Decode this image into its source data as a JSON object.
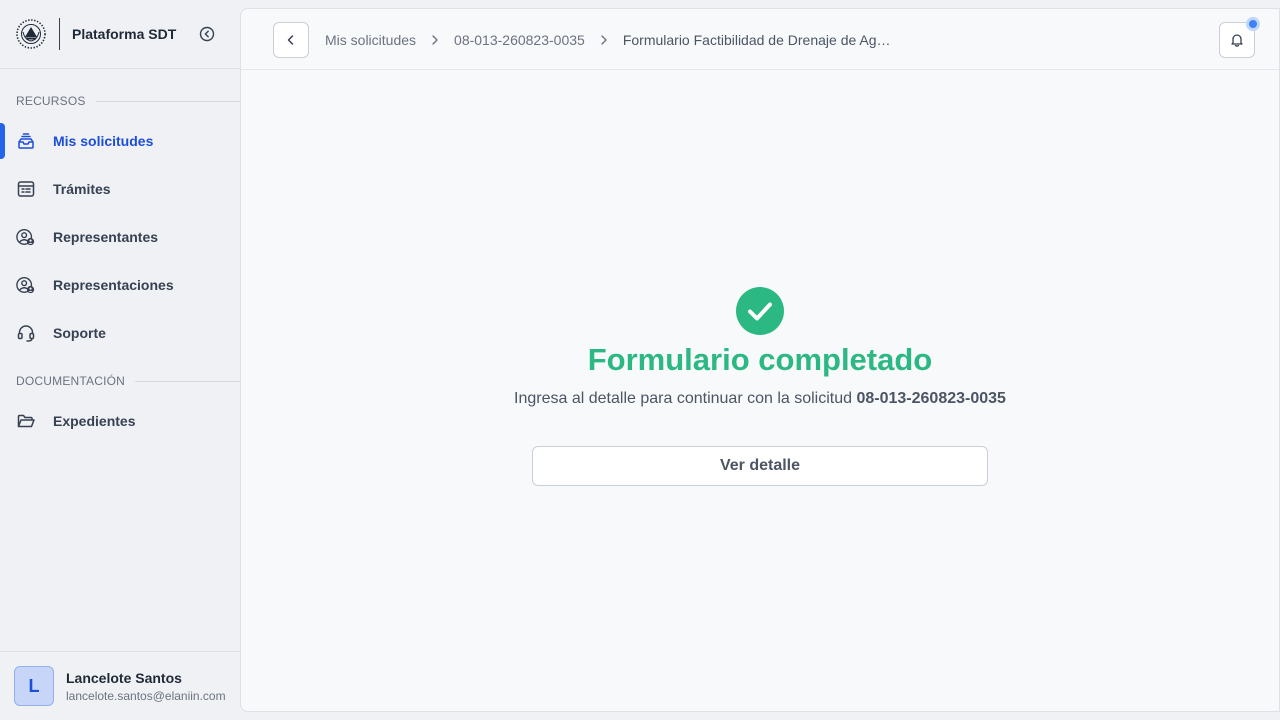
{
  "app": {
    "title": "Plataforma SDT"
  },
  "sidebar": {
    "sections": [
      {
        "label": "RECURSOS"
      },
      {
        "label": "DOCUMENTACIÓN"
      }
    ],
    "items": [
      {
        "label": "Mis solicitudes",
        "icon": "inbox-stack-icon",
        "active": true
      },
      {
        "label": "Trámites",
        "icon": "calendar-table-icon"
      },
      {
        "label": "Representantes",
        "icon": "user-circle-badge-icon"
      },
      {
        "label": "Representaciones",
        "icon": "user-circle-badge-icon"
      },
      {
        "label": "Soporte",
        "icon": "headset-icon"
      },
      {
        "label": "Expedientes",
        "icon": "folder-open-icon"
      }
    ]
  },
  "user": {
    "initial": "L",
    "name": "Lancelote Santos",
    "email": "lancelote.santos@elaniin.com"
  },
  "breadcrumb": {
    "items": [
      "Mis solicitudes",
      "08-013-260823-0035",
      "Formulario Factibilidad de Drenaje de Aguas Lluvias"
    ]
  },
  "main": {
    "title": "Formulario completado",
    "subtitle_prefix": "Ingresa al detalle para continuar con la solicitud",
    "request_code": "08-013-260823-0035",
    "button_label": "Ver detalle"
  },
  "colors": {
    "accent": "#2563eb",
    "success": "#2bb882",
    "notification": "#3b82f6"
  }
}
